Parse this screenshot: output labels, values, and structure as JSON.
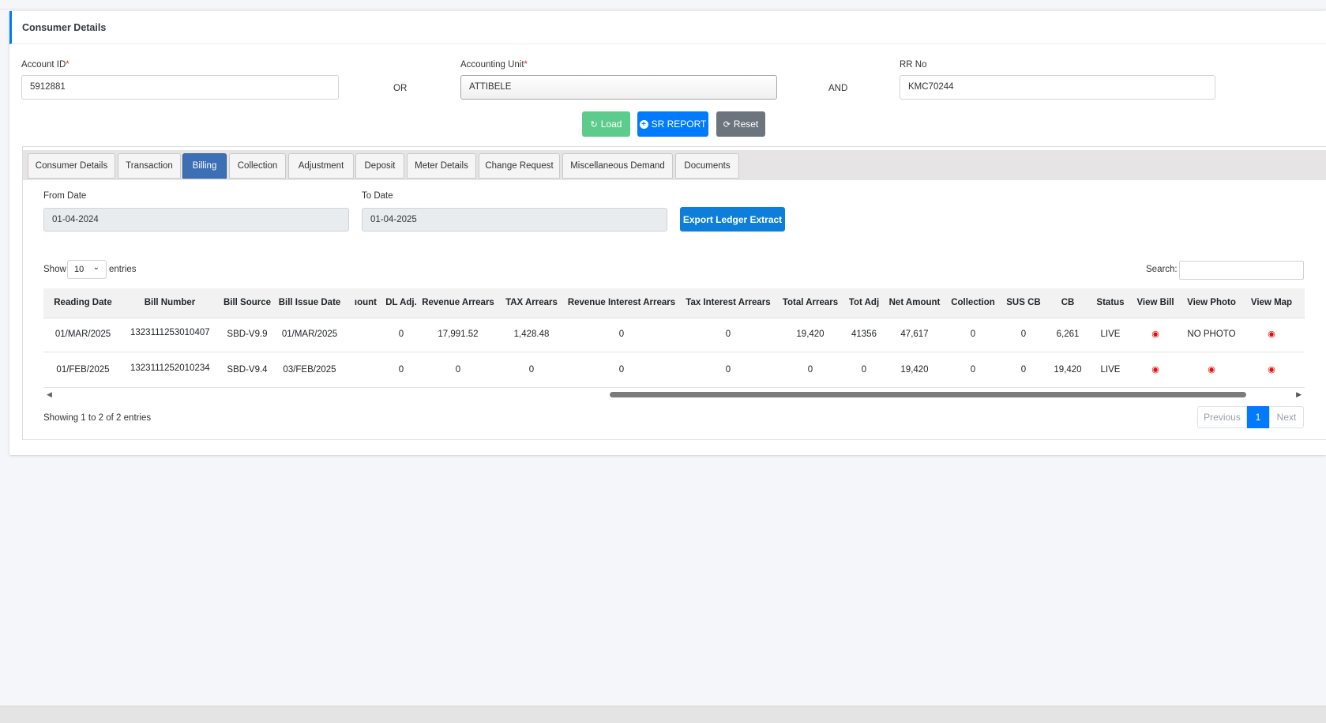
{
  "card": {
    "title": "Consumer Details"
  },
  "form": {
    "account_id_label": "Account ID",
    "account_id_value": "5912881",
    "or_label": "OR",
    "accounting_unit_label": "Accounting Unit",
    "accounting_unit_value": "ATTIBELE",
    "and_label": "AND",
    "rr_no_label": "RR No",
    "rr_no_value": "KMC70244",
    "required_mark": "*"
  },
  "actions": {
    "load": "Load",
    "sr_report": "SR REPORT",
    "reset": "Reset"
  },
  "tabs": [
    "Consumer Details",
    "Transaction",
    "Billing",
    "Collection",
    "Adjustment",
    "Deposit",
    "Meter Details",
    "Change Request",
    "Miscellaneous Demand",
    "Documents"
  ],
  "active_tab": "Billing",
  "filters": {
    "from_label": "From Date",
    "from_value": "01-04-2024",
    "to_label": "To Date",
    "to_value": "01-04-2025",
    "export": "Export Ledger Extract"
  },
  "datatable": {
    "show_label": "Show",
    "page_size": "10",
    "entries_label": "entries",
    "search_label": "Search:",
    "info": "Showing 1 to 2 of 2 entries",
    "prev": "Previous",
    "page": "1",
    "next": "Next"
  },
  "table": {
    "columns": [
      "Reading Date",
      "Bill Number",
      "Bill Source",
      "Bill Issue Date",
      "ıount",
      "DL Adj.",
      "Revenue Arrears",
      "TAX Arrears",
      "Revenue Interest Arrears",
      "Tax Interest Arrears",
      "Total Arrears",
      "Tot Adj",
      "Net Amount",
      "Collection",
      "SUS CB",
      "CB",
      "Status",
      "View Bill",
      "View Photo",
      "View Map"
    ],
    "rows": [
      {
        "reading_date": "01/MAR/2025",
        "bill_number": "1323111253010407",
        "bill_source": "SBD-V9.9",
        "bill_issue_date": "01/MAR/2025",
        "dl_adj": "0",
        "revenue_arrears": "17,991.52",
        "tax_arrears": "1,428.48",
        "revenue_interest_arrears": "0",
        "tax_interest_arrears": "0",
        "total_arrears": "19,420",
        "tot_adj": "41356",
        "net_amount": "47,617",
        "collection": "0",
        "sus_cb": "0",
        "cb": "6,261",
        "status": "LIVE",
        "view_photo": "NO PHOTO"
      },
      {
        "reading_date": "01/FEB/2025",
        "bill_number": "1323111252010234",
        "bill_source": "SBD-V9.4",
        "bill_issue_date": "03/FEB/2025",
        "dl_adj": "0",
        "revenue_arrears": "0",
        "tax_arrears": "0",
        "revenue_interest_arrears": "0",
        "tax_interest_arrears": "0",
        "total_arrears": "0",
        "tot_adj": "0",
        "net_amount": "19,420",
        "collection": "0",
        "sus_cb": "0",
        "cb": "19,420",
        "status": "LIVE",
        "view_photo": ""
      }
    ]
  },
  "icons": {
    "eye": "eye-icon",
    "load": "spinner-icon",
    "sr_report": "plus-circle-icon",
    "reset": "refresh-icon",
    "select": "chevron-down-icon"
  },
  "colors": {
    "accent": "#007bff",
    "active_tab": "#3c6fb4",
    "load": "#5ccb8c",
    "reset": "#6c757d",
    "eye": "#e30d0d"
  }
}
